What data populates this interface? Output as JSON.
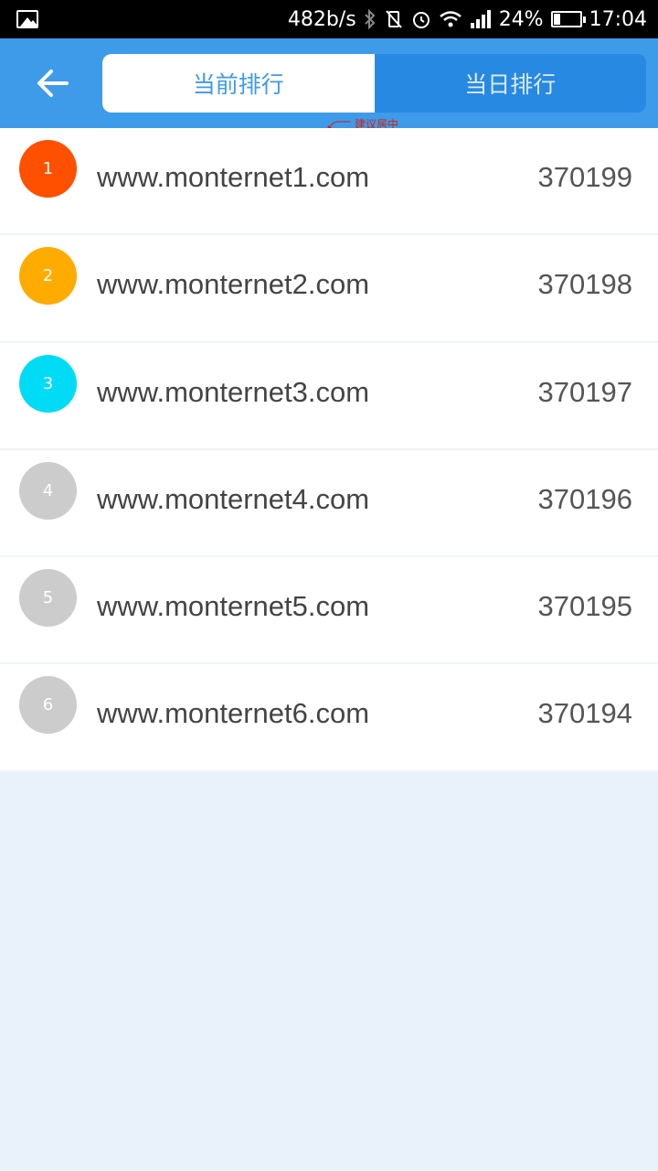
{
  "status_bar": {
    "speed": "482b/s",
    "battery": "24%",
    "battery_level": 0.24,
    "time": "17:04",
    "icons": [
      "gallery-icon",
      "bluetooth-icon",
      "vibrate-off-icon",
      "alarm-icon",
      "wifi-icon",
      "signal-icon",
      "battery-icon"
    ]
  },
  "header": {
    "back_icon": "back-arrow-icon",
    "tabs": [
      {
        "label": "当前排行",
        "active": true
      },
      {
        "label": "当日排行",
        "active": false
      }
    ],
    "annotation": "建议居中",
    "colors": {
      "app_bar": "#3d9be9",
      "active_tab_bg": "#ffffff",
      "inactive_tab_bg": "#2789e2"
    }
  },
  "list": {
    "items": [
      {
        "rank": "1",
        "site": "www.monternet1.com",
        "score": "370199",
        "color": "#ff5000"
      },
      {
        "rank": "2",
        "site": "www.monternet2.com",
        "score": "370198",
        "color": "#ffab00"
      },
      {
        "rank": "3",
        "site": "www.monternet3.com",
        "score": "370197",
        "color": "#00dcf5"
      },
      {
        "rank": "4",
        "site": "www.monternet4.com",
        "score": "370196",
        "color": "#cccccc"
      },
      {
        "rank": "5",
        "site": "www.monternet5.com",
        "score": "370195",
        "color": "#cccccc"
      },
      {
        "rank": "6",
        "site": "www.monternet6.com",
        "score": "370194",
        "color": "#cccccc"
      }
    ]
  }
}
